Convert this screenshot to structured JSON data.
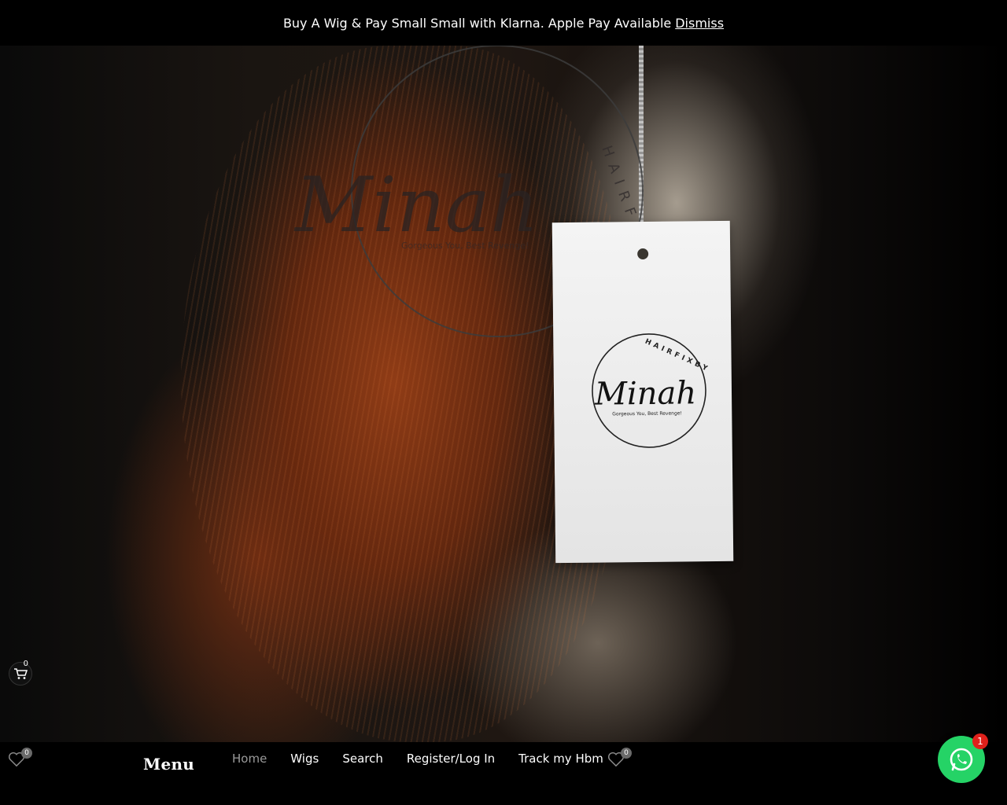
{
  "notice": {
    "text": "Buy A Wig & Pay Small Small with Klarna. Apple Pay Available",
    "dismiss_label": "Dismiss"
  },
  "hero": {
    "watermark_text": "Minah",
    "watermark_tagline": "Gorgeous You, Best Revenge!",
    "watermark_ring": "HAIRFIXBYMINAH",
    "tag_logo_text": "Minah",
    "tag_tagline": "Gorgeous You, Best Revenge!",
    "tag_ring": "HAIRFIXBYMINAH"
  },
  "floating_cart": {
    "count": "0",
    "icon": "cart-icon"
  },
  "bottom_nav": {
    "wishlist_left_count": "0",
    "menu_title": "Menu",
    "items": [
      {
        "label": "Home",
        "active": true
      },
      {
        "label": "Wigs"
      },
      {
        "label": "Search"
      },
      {
        "label": "Register/Log In"
      },
      {
        "label": "Track my Hbm"
      }
    ],
    "wishlist_count": "0"
  },
  "whatsapp": {
    "badge": "1",
    "icon": "whatsapp-icon",
    "color": "#25d366"
  }
}
